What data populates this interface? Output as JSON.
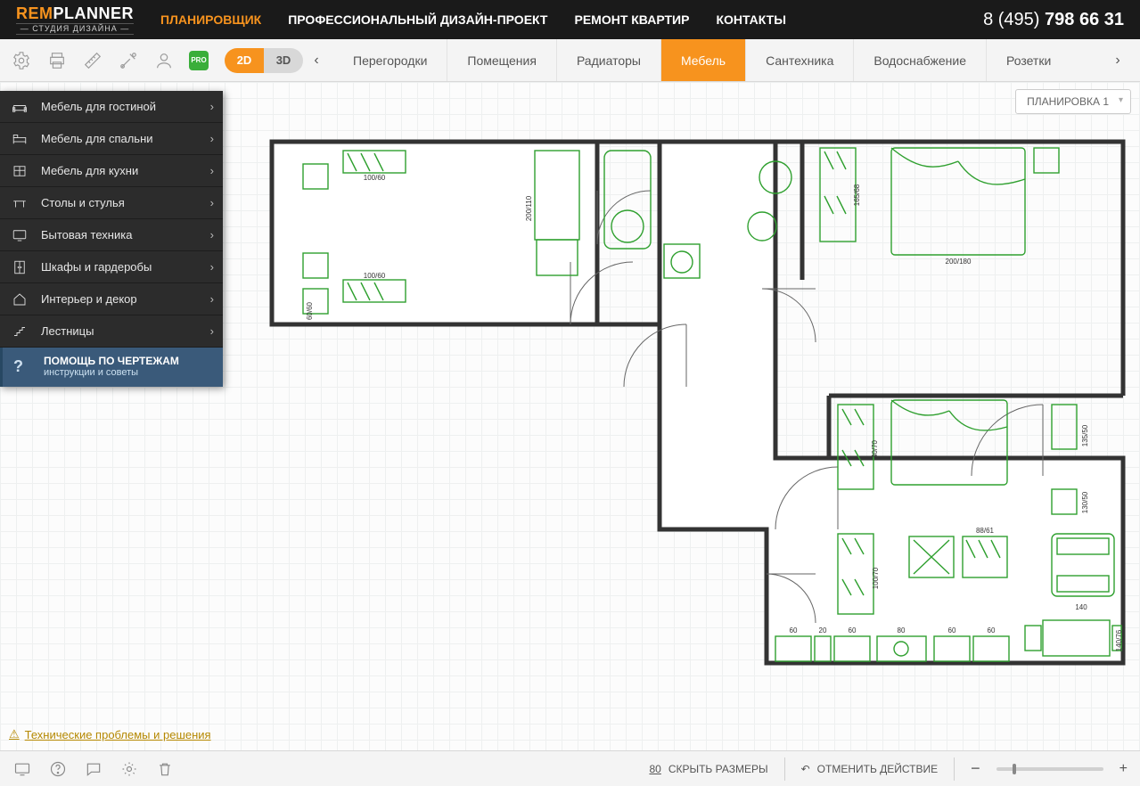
{
  "logo": {
    "brand_left": "REM",
    "brand_right": "PLANNER",
    "sub": "— СТУДИЯ ДИЗАЙНА —"
  },
  "nav": {
    "items": [
      "ПЛАНИРОВЩИК",
      "ПРОФЕССИОНАЛЬНЫЙ ДИЗАЙН-ПРОЕКТ",
      "РЕМОНТ КВАРТИР",
      "КОНТАКТЫ"
    ],
    "active_index": 0
  },
  "phone": {
    "prefix": "8 (495) ",
    "number": "798 66 31"
  },
  "toolbar": {
    "pro": "PRO",
    "view2d": "2D",
    "view3d": "3D",
    "tabs": [
      "Перегородки",
      "Помещения",
      "Радиаторы",
      "Мебель",
      "Сантехника",
      "Водоснабжение",
      "Розетки"
    ],
    "active_tab_index": 3
  },
  "plan_dropdown": "ПЛАНИРОВКА 1",
  "sidebar": {
    "items": [
      {
        "label": "Мебель для гостиной"
      },
      {
        "label": "Мебель для спальни"
      },
      {
        "label": "Мебель для кухни"
      },
      {
        "label": "Столы и стулья"
      },
      {
        "label": "Бытовая техника"
      },
      {
        "label": "Шкафы и гардеробы"
      },
      {
        "label": "Интерьер и декор"
      },
      {
        "label": "Лестницы"
      }
    ],
    "help": {
      "title": "ПОМОЩЬ ПО ЧЕРТЕЖАМ",
      "subtitle": "инструкции и советы"
    }
  },
  "tech_link": "Технические проблемы и решения",
  "bottom": {
    "hide_sizes_num": "80",
    "hide_sizes": "СКРЫТЬ РАЗМЕРЫ",
    "undo": "ОТМЕНИТЬ ДЕЙСТВИЕ",
    "minus": "−",
    "plus": "+"
  },
  "dims": {
    "d1": "100/60",
    "d2": "200/110",
    "d3": "100/60",
    "d4": "60/60",
    "d5": "165/68",
    "d6": "200/180",
    "d7": "40/70",
    "d8": "135/50",
    "d9": "130/50",
    "d10": "100/70",
    "d11": "88/61",
    "d12": "140",
    "d13": "60",
    "d14": "20",
    "d15": "60",
    "d16": "80",
    "d17": "60",
    "d18": "60",
    "d19": "140/76"
  }
}
